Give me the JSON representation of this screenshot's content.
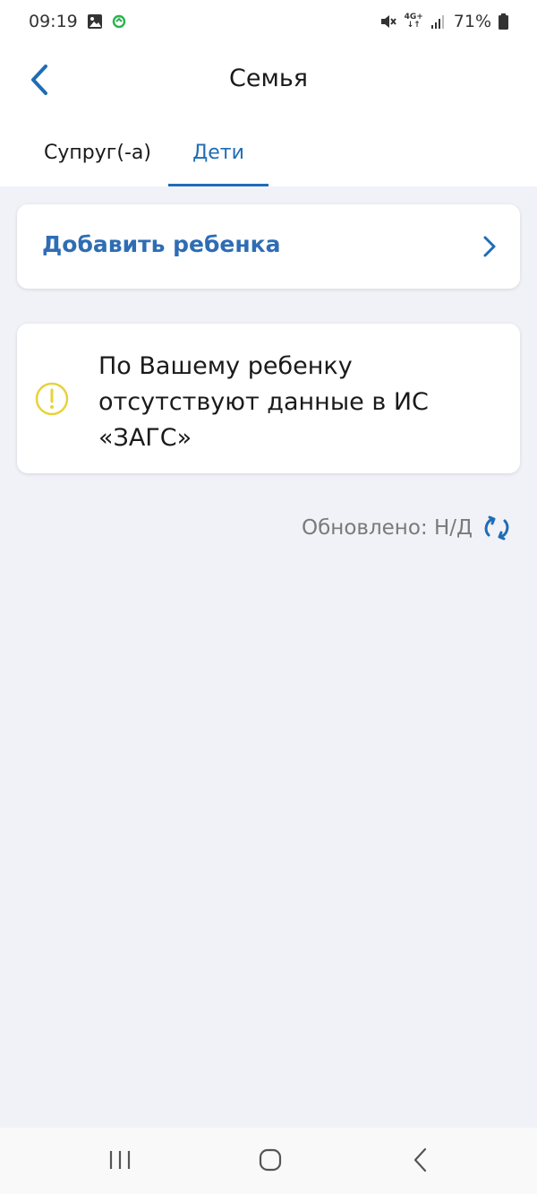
{
  "status_bar": {
    "time": "09:19",
    "network_top": "4G+",
    "network_bottom": "↓↑",
    "battery": "71%"
  },
  "header": {
    "title": "Семья"
  },
  "tabs": [
    {
      "label": "Супруг(-а)",
      "active": false
    },
    {
      "label": "Дети",
      "active": true
    }
  ],
  "add_child": {
    "label": "Добавить ребенка"
  },
  "info": {
    "message": "По Вашему ребенку отсутствуют данные в ИС «ЗАГС»"
  },
  "updated": {
    "text": "Обновлено: Н/Д"
  },
  "colors": {
    "accent": "#1f6cb6",
    "warning": "#e8d23a",
    "background": "#f1f2f7"
  },
  "icons": [
    "image-icon",
    "sync-icon",
    "mute-icon",
    "signal-icon",
    "battery-icon",
    "back-arrow-icon",
    "chevron-right-icon",
    "warning-icon",
    "refresh-icon",
    "recents-icon",
    "home-icon",
    "nav-back-icon"
  ]
}
